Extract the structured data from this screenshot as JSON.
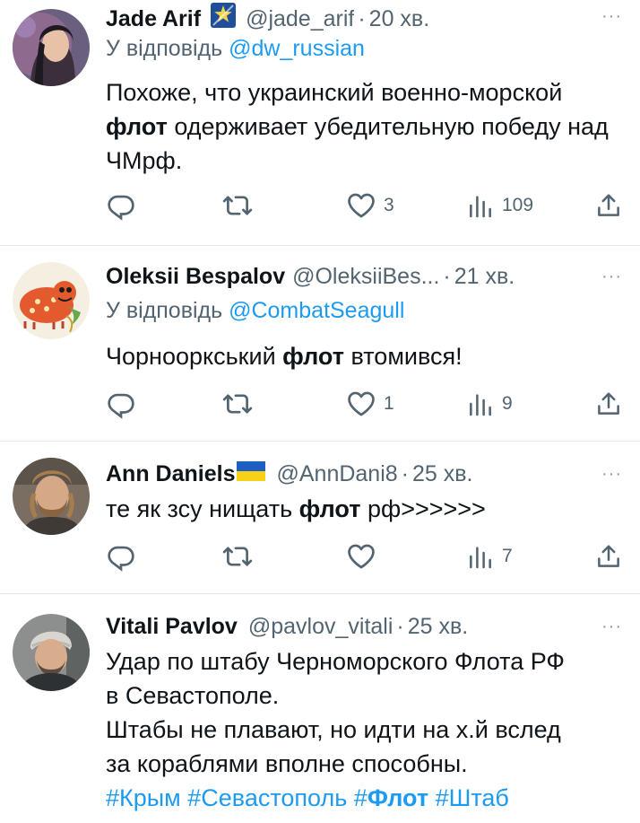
{
  "colors": {
    "link": "#1d9bf0",
    "muted": "#536471",
    "text": "#0f1419",
    "divider": "#e6e9eb"
  },
  "tweets": [
    {
      "name": "Jade Arif",
      "badge": "verified-star-badge",
      "handle": "@jade_arif",
      "time": "20 хв.",
      "reply_prefix": "У відповідь",
      "reply_to": "@dw_russian",
      "text_1": "Похоже, что украинский военно-морской",
      "text_bold": "флот",
      "text_2": "одерживает убедительную победу над ЧМрф.",
      "likes": "3",
      "views": "109"
    },
    {
      "name": "Oleksii Bespalov",
      "handle": "@OleksiiBes...",
      "time": "21 хв.",
      "reply_prefix": "У відповідь",
      "reply_to": "@CombatSeagull",
      "text_1": "Чорнооркський",
      "text_bold": "флот",
      "text_2": "втомився!",
      "likes": "1",
      "views": "9"
    },
    {
      "name": "Ann Daniels",
      "badge": "ukraine-flag-badge",
      "handle": "@AnnDani8",
      "time": "25 хв.",
      "text_1": "те як зсу нищать",
      "text_bold": "флот",
      "text_2": "рф>>>>>>",
      "likes": "",
      "views": "7"
    },
    {
      "name": "Vitali Pavlov",
      "handle": "@pavlov_vitali",
      "time": "25 хв.",
      "line_1": "Удар по штабу Черноморского Флота РФ",
      "line_2": "в Севастополе.",
      "line_3": "Штабы не плавают, но идти на х.й вслед",
      "line_4": "за кораблями вполне способны.",
      "tag_1": "#Крым",
      "tag_2": "#Севастополь",
      "tag_3_prefix": "#",
      "tag_3_bold": "Флот",
      "tag_4": "#Штаб"
    }
  ],
  "dot": "·",
  "more": "···"
}
